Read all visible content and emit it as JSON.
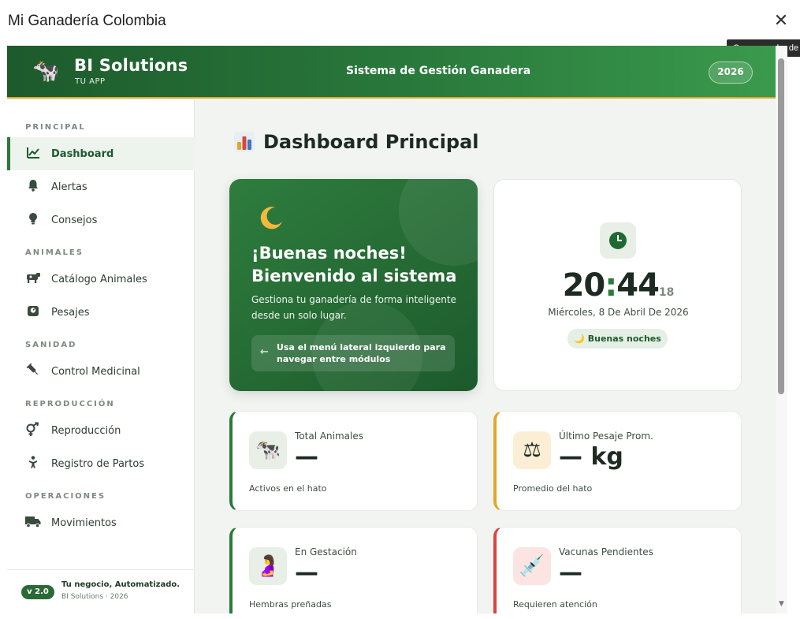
{
  "dialog": {
    "title": "Mi Ganadería Colombia",
    "close_glyph": "✕",
    "close_tooltip": "Cerrar cuadro de"
  },
  "header": {
    "logo_icon": "cow-icon",
    "logo_glyph": "🐄",
    "brand": "BI Solutions",
    "brand_sub": "TU APP",
    "center_title": "Sistema de Gestión Ganadera",
    "year": "2026"
  },
  "sidebar": {
    "sections": {
      "principal": "PRINCIPAL",
      "animales": "ANIMALES",
      "sanidad": "SANIDAD",
      "reproduccion": "REPRODUCCIÓN",
      "operaciones": "OPERACIONES"
    },
    "items": [
      {
        "label": "Dashboard",
        "icon": "chart-line-icon",
        "glyph": "📈",
        "active": true
      },
      {
        "label": "Alertas",
        "icon": "bell-icon",
        "glyph": "🔔",
        "active": false
      },
      {
        "label": "Consejos",
        "icon": "lightbulb-icon",
        "glyph": "💡",
        "active": false
      },
      {
        "label": "Catálogo Animales",
        "icon": "cow-icon",
        "glyph": "🐄",
        "active": false
      },
      {
        "label": "Pesajes",
        "icon": "weight-icon",
        "glyph": "⚖",
        "active": false
      },
      {
        "label": "Control Medicinal",
        "icon": "syringe-icon",
        "glyph": "💉",
        "active": false
      },
      {
        "label": "Reproducción",
        "icon": "venus-mars-icon",
        "glyph": "⚥",
        "active": false
      },
      {
        "label": "Registro de Partos",
        "icon": "baby-icon",
        "glyph": "👶",
        "active": false
      },
      {
        "label": "Movimientos",
        "icon": "truck-icon",
        "glyph": "🚚",
        "active": false
      }
    ],
    "footer": {
      "version": "v 2.0",
      "tagline": "Tu negocio, Automatizado.",
      "copyright": "BI Solutions · 2026"
    }
  },
  "main": {
    "title": "Dashboard Principal",
    "title_icon": "bar-chart-icon",
    "welcome": {
      "icon": "moon-icon",
      "glyph": "🌙",
      "greeting": "¡Buenas noches! Bienvenido al sistema",
      "description": "Gestiona tu ganadería de forma inteligente desde un solo lugar.",
      "hint_arrow": "←",
      "hint": "Usa el menú lateral izquierdo para navegar entre módulos"
    },
    "clock": {
      "icon": "clock-icon",
      "hours": "20",
      "colon": ":",
      "minutes": "44",
      "seconds": "18",
      "date": "Miércoles, 8 De Abril De 2026",
      "period": "🌙 Buenas noches"
    },
    "stats": [
      {
        "label": "Total Animales",
        "value": "—",
        "foot": "Activos en el hato",
        "icon": "cow-icon",
        "glyph": "🐄",
        "accent": "#2a7a3c"
      },
      {
        "label": "Último Pesaje Prom.",
        "value": "— kg",
        "foot": "Promedio del hato",
        "icon": "scale-icon",
        "glyph": "⚖",
        "accent": "#e0a72a"
      },
      {
        "label": "En Gestación",
        "value": "—",
        "foot": "Hembras preñadas",
        "icon": "pregnant-icon",
        "glyph": "🤰",
        "accent": "#2a7a3c"
      },
      {
        "label": "Vacunas Pendientes",
        "value": "—",
        "foot": "Requieren atención",
        "icon": "syringe-icon",
        "glyph": "💉",
        "accent": "#d8473c"
      }
    ]
  },
  "colors": {
    "brand_green": "#2a7a3c",
    "dark_green": "#1d5a2c",
    "accent_gold": "#e0a72a",
    "accent_red": "#d8473c"
  }
}
